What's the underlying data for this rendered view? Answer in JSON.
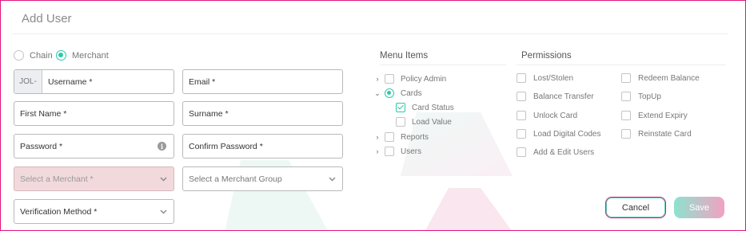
{
  "dialog": {
    "title": "Add User"
  },
  "user_type": {
    "options": [
      {
        "label": "Chain",
        "selected": false
      },
      {
        "label": "Merchant",
        "selected": true
      }
    ]
  },
  "form": {
    "username_prefix": "JOL-",
    "username": "Username *",
    "email": "Email *",
    "first_name": "First Name *",
    "surname": "Surname *",
    "password": "Password *",
    "confirm_password": "Confirm Password *",
    "merchant_select": "Select a Merchant *",
    "merchant_group_select": "Select a Merchant Group",
    "verification_method": "Verification Method *"
  },
  "menu_items": {
    "heading": "Menu Items",
    "items": [
      {
        "label": "Policy Admin",
        "expanded": false,
        "checked": false
      },
      {
        "label": "Cards",
        "expanded": true,
        "checked": "partial",
        "children": [
          {
            "label": "Card Status",
            "checked": true
          },
          {
            "label": "Load Value",
            "checked": false
          }
        ]
      },
      {
        "label": "Reports",
        "expanded": false,
        "checked": false
      },
      {
        "label": "Users",
        "expanded": false,
        "checked": false
      }
    ]
  },
  "permissions": {
    "heading": "Permissions",
    "left": [
      "Lost/Stolen",
      "Balance Transfer",
      "Unlock Card",
      "Load Digital Codes",
      "Add & Edit Users"
    ],
    "right": [
      "Redeem Balance",
      "TopUp",
      "Extend Expiry",
      "Reinstate Card"
    ]
  },
  "actions": {
    "cancel": "Cancel",
    "save": "Save"
  },
  "colors": {
    "accent": "#2ec8a9",
    "brand": "#e3147e",
    "error_fill": "#f2d9dc"
  }
}
